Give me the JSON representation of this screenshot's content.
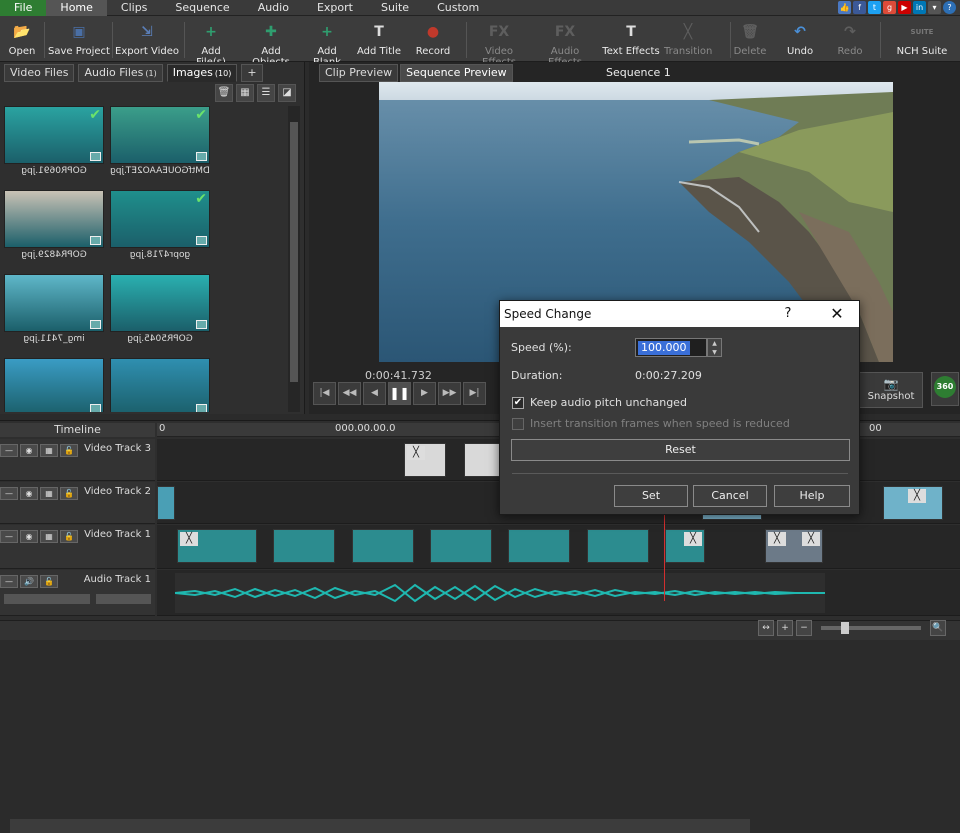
{
  "menu": [
    "File",
    "Home",
    "Clips",
    "Sequence",
    "Audio",
    "Export",
    "Suite",
    "Custom"
  ],
  "menu_active": "Home",
  "toolbar": [
    {
      "label": "Open",
      "icon": "folder-icon",
      "glyph": "📂",
      "enabled": true
    },
    {
      "label": "Save Project",
      "icon": "save-icon",
      "glyph": "▣",
      "enabled": true
    },
    {
      "label": "Export Video",
      "icon": "export-video-icon",
      "glyph": "⇲",
      "enabled": true
    },
    {
      "label": "Add File(s)",
      "icon": "add-file-icon",
      "glyph": "+",
      "enabled": true
    },
    {
      "label": "Add Objects",
      "icon": "add-objects-icon",
      "glyph": "✚",
      "enabled": true
    },
    {
      "label": "Add Blank",
      "icon": "add-blank-icon",
      "glyph": "+",
      "enabled": true
    },
    {
      "label": "Add Title",
      "icon": "add-title-icon",
      "glyph": "T",
      "enabled": true
    },
    {
      "label": "Record",
      "icon": "record-icon",
      "glyph": "●",
      "enabled": true
    },
    {
      "label": "Video Effects",
      "icon": "video-effects-icon",
      "glyph": "FX",
      "enabled": false
    },
    {
      "label": "Audio Effects",
      "icon": "audio-effects-icon",
      "glyph": "FX",
      "enabled": false
    },
    {
      "label": "Text Effects",
      "icon": "text-effects-icon",
      "glyph": "T",
      "enabled": true
    },
    {
      "label": "Transition",
      "icon": "transition-icon",
      "glyph": "╳",
      "enabled": false
    },
    {
      "label": "Delete",
      "icon": "trash-icon",
      "glyph": "🗑",
      "enabled": false
    },
    {
      "label": "Undo",
      "icon": "undo-icon",
      "glyph": "↶",
      "enabled": true
    },
    {
      "label": "Redo",
      "icon": "redo-icon",
      "glyph": "↷",
      "enabled": false
    },
    {
      "label": "NCH Suite",
      "icon": "nch-suite-icon",
      "glyph": "SUITE",
      "enabled": true
    }
  ],
  "media_tabs": [
    {
      "label": "Video Files",
      "count": ""
    },
    {
      "label": "Audio Files",
      "count": "(1)"
    },
    {
      "label": "Images",
      "count": "(10)"
    },
    {
      "label": "+",
      "count": ""
    }
  ],
  "media_items": [
    {
      "name": "GOPR0691.jpg",
      "checked": true,
      "color": "#2aa3a1"
    },
    {
      "name": "DMtfGOUEAAO2ET.jpg",
      "checked": true,
      "color": "#3b9e8a"
    },
    {
      "name": "GOPR4829.jpg",
      "checked": false,
      "color": "#c9c2b5"
    },
    {
      "name": "gopr4718.jpg",
      "checked": true,
      "color": "#1f8f8c"
    },
    {
      "name": "img_7411.jpg",
      "checked": false,
      "color": "#5fb7c9"
    },
    {
      "name": "GOPR5045.jpg",
      "checked": false,
      "color": "#2ab0b0"
    },
    {
      "name": "",
      "checked": false,
      "color": "#3a9cc4"
    },
    {
      "name": "",
      "checked": false,
      "color": "#2f8fb0"
    }
  ],
  "preview": {
    "tabs": [
      "Clip Preview",
      "Sequence Preview"
    ],
    "active_tab": "Sequence Preview",
    "sequence_title": "Sequence 1",
    "time": "0:00:41.732",
    "snapshot_label": "Snapshot",
    "badge_360": "360"
  },
  "timeline": {
    "title": "Timeline",
    "ruler": [
      "0",
      "000.00.00.0",
      "00"
    ],
    "tracks": [
      "Video Track 3",
      "Video Track 2",
      "Video Track 1",
      "Audio Track 1"
    ]
  },
  "dialog": {
    "title": "Speed Change",
    "help": "?",
    "close": "✕",
    "speed_label": "Speed (%):",
    "speed_value": "100.000",
    "duration_label": "Duration:",
    "duration_value": "0:00:27.209",
    "keep_pitch_label": "Keep audio pitch unchanged",
    "keep_pitch_checked": true,
    "insert_frames_label": "Insert transition frames when speed is reduced",
    "insert_frames_enabled": false,
    "reset_label": "Reset",
    "set_label": "Set",
    "cancel_label": "Cancel",
    "help_label": "Help"
  },
  "colors": {
    "accent_green": "#2e7d32",
    "clip_teal": "#2c8c8f",
    "playhead": "#d32f2f",
    "selection": "#3a6fd8"
  }
}
